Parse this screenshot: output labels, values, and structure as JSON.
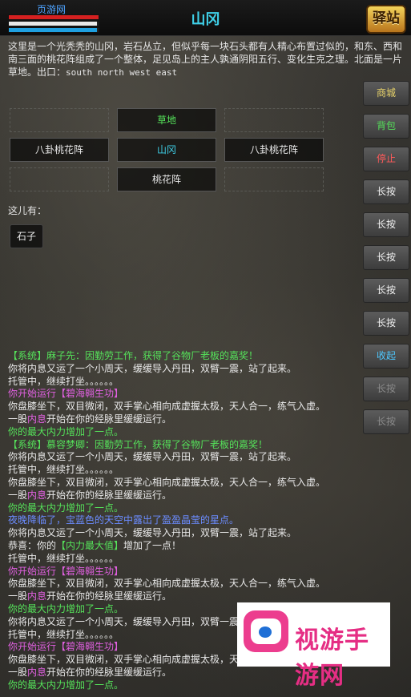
{
  "header": {
    "player_name": "页游网",
    "hp_fraction": 1.0,
    "mp_fraction": 0.98,
    "exp_fraction": 0.98,
    "room_title": "山冈",
    "logo_text": "驿站"
  },
  "room": {
    "description": "这里是一个光秃秃的山冈，岩石丛立，但似乎每一块石头都有人精心布置过似的，和东、西和南三面的桃花阵组成了一个整体，足见岛上的主人孰通阴阳五行、变化生克之理。北面是一片草地。出口：",
    "exits": "south  north  west  east"
  },
  "map": {
    "north": "草地",
    "west": "八卦桃花阵",
    "center": "山冈",
    "east": "八卦桃花阵",
    "south": "桃花阵"
  },
  "here_label": "这儿有：",
  "npcs": [
    "石子"
  ],
  "side_buttons": [
    {
      "label": "商城",
      "color": "#e8d36a"
    },
    {
      "label": "背包",
      "color": "#55e25a"
    },
    {
      "label": "停止",
      "color": "#ff5a5a"
    },
    {
      "label": "长按",
      "color": "#f0f0f0"
    },
    {
      "label": "长按",
      "color": "#f0f0f0"
    },
    {
      "label": "长按",
      "color": "#f0f0f0"
    },
    {
      "label": "长按",
      "color": "#f0f0f0"
    },
    {
      "label": "长按",
      "color": "#f0f0f0"
    },
    {
      "label": "收起",
      "color": "#4ec8ff"
    },
    {
      "label": "长按",
      "color": "#8a8a8a"
    },
    {
      "label": "长按",
      "color": "#8a8a8a"
    }
  ],
  "log": [
    {
      "segments": [
        {
          "t": "【系统】麻子先：因勤劳工作，获得了谷物厂老板的嘉奖！",
          "c": "#55e25a"
        }
      ]
    },
    {
      "segments": [
        {
          "t": "你将内息又运了一个小周天，缓缓导入丹田，双臂一震，站了起来。",
          "c": "#e8e8e8"
        }
      ]
    },
    {
      "segments": [
        {
          "t": "托管中，继续打坐。。。。。。",
          "c": "#e8e8e8"
        }
      ]
    },
    {
      "segments": [
        {
          "t": "你开始运行【碧海翱生功】",
          "c": "#e060e0"
        }
      ]
    },
    {
      "segments": [
        {
          "t": "你盘膝坐下，双目微闭，双手掌心相向成虚握太极，天人合一，练气入虚。",
          "c": "#e8e8e8"
        }
      ]
    },
    {
      "segments": [
        {
          "t": "一股",
          "c": "#e8e8e8"
        },
        {
          "t": "内息",
          "c": "#e060e0"
        },
        {
          "t": "开始在你的经脉里缓缓运行。",
          "c": "#e8e8e8"
        }
      ]
    },
    {
      "segments": [
        {
          "t": "你的最大内力增加了一点。",
          "c": "#55e25a"
        }
      ]
    },
    {
      "segments": [
        {
          "t": "【系统】慕容梦卿：因勤劳工作，获得了谷物厂老板的嘉奖！",
          "c": "#55e25a"
        }
      ]
    },
    {
      "segments": [
        {
          "t": "你将内息又运了一个小周天，缓缓导入丹田，双臂一震，站了起来。",
          "c": "#e8e8e8"
        }
      ]
    },
    {
      "segments": [
        {
          "t": "托管中，继续打坐。。。。。。",
          "c": "#e8e8e8"
        }
      ]
    },
    {
      "segments": [
        {
          "t": "你盘膝坐下，双目微闭，双手掌心相向成虚握太极，天人合一，练气入虚。",
          "c": "#e8e8e8"
        }
      ]
    },
    {
      "segments": [
        {
          "t": "一股",
          "c": "#e8e8e8"
        },
        {
          "t": "内息",
          "c": "#e060e0"
        },
        {
          "t": "开始在你的经脉里缓缓运行。",
          "c": "#e8e8e8"
        }
      ]
    },
    {
      "segments": [
        {
          "t": "你的最大内力增加了一点。",
          "c": "#55e25a"
        }
      ]
    },
    {
      "segments": [
        {
          "t": "夜晚降临了，宝蓝色的天空中露出了盈盈晶莹的星点。",
          "c": "#6b8cff"
        }
      ]
    },
    {
      "segments": [
        {
          "t": "你将内息又运了一个小周天，缓缓导入丹田，双臂一震，站了起来。",
          "c": "#e8e8e8"
        }
      ]
    },
    {
      "segments": [
        {
          "t": "恭喜：你的",
          "c": "#e8e8e8"
        },
        {
          "t": "【内力最大值】",
          "c": "#55e25a"
        },
        {
          "t": "增加了一点！",
          "c": "#e8e8e8"
        }
      ]
    },
    {
      "segments": [
        {
          "t": "托管中，继续打坐。。。。。。",
          "c": "#e8e8e8"
        }
      ]
    },
    {
      "segments": [
        {
          "t": "你开始运行【碧海翱生功】",
          "c": "#e060e0"
        }
      ]
    },
    {
      "segments": [
        {
          "t": "你盘膝坐下，双目微闭，双手掌心相向成虚握太极，天人合一，练气入虚。",
          "c": "#e8e8e8"
        }
      ]
    },
    {
      "segments": [
        {
          "t": "一股",
          "c": "#e8e8e8"
        },
        {
          "t": "内息",
          "c": "#e060e0"
        },
        {
          "t": "开始在你的经脉里缓缓运行。",
          "c": "#e8e8e8"
        }
      ]
    },
    {
      "segments": [
        {
          "t": "你的最大内力增加了一点。",
          "c": "#55e25a"
        }
      ]
    },
    {
      "segments": [
        {
          "t": "你将内息又运了一个小周天，缓缓导入丹田，双臂一震，站了起来。",
          "c": "#e8e8e8"
        }
      ]
    },
    {
      "segments": [
        {
          "t": "托管中，继续打坐。。。。。。",
          "c": "#e8e8e8"
        }
      ]
    },
    {
      "segments": [
        {
          "t": "你开始运行【碧海翱生功】",
          "c": "#e060e0"
        }
      ]
    },
    {
      "segments": [
        {
          "t": "你盘膝坐下，双目微闭，双手掌心相向成虚握太极，天人合一，练气入虚。",
          "c": "#e8e8e8"
        }
      ]
    },
    {
      "segments": [
        {
          "t": "一股",
          "c": "#e8e8e8"
        },
        {
          "t": "内息",
          "c": "#e060e0"
        },
        {
          "t": "开始在你的经脉里缓缓运行。",
          "c": "#e8e8e8"
        }
      ]
    },
    {
      "segments": [
        {
          "t": "你的最大内力增加了一点。",
          "c": "#55e25a"
        }
      ]
    }
  ],
  "watermark": {
    "text": "视游手游网",
    "icon": "tv-logo-icon"
  }
}
